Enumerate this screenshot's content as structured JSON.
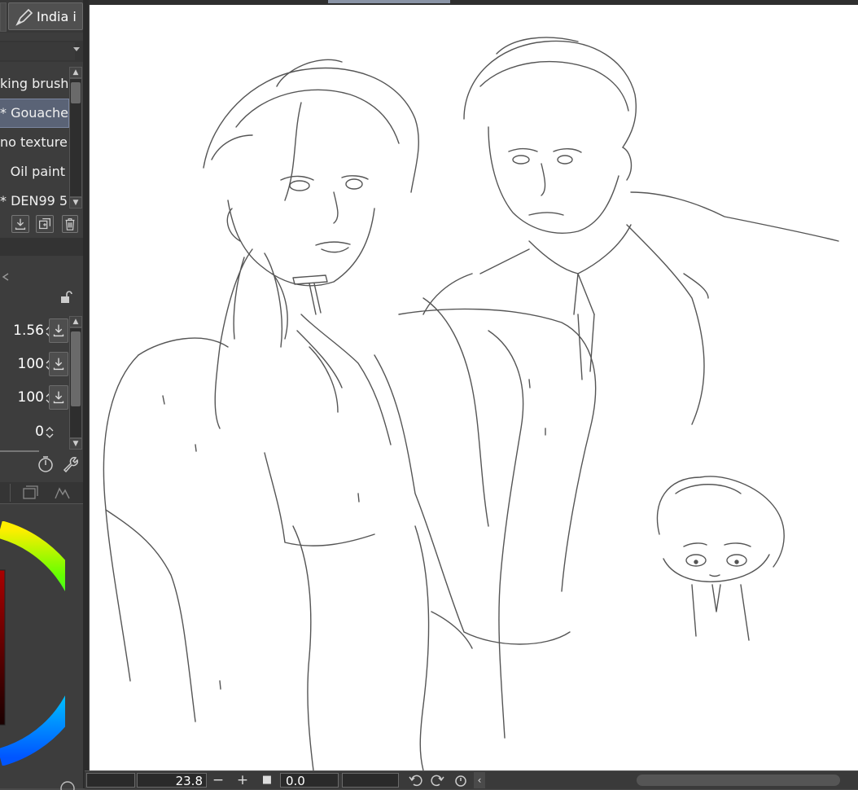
{
  "tool_header": {
    "active_tool": "India i",
    "icon": "pen-icon"
  },
  "brush_list": {
    "items": [
      {
        "label": "king brush",
        "selected": false
      },
      {
        "label": "* Gouache",
        "selected": true
      },
      {
        "label": "no texture",
        "selected": false
      },
      {
        "label": "Oil paint",
        "selected": false
      },
      {
        "label": "* DEN99 5",
        "selected": false
      }
    ]
  },
  "tool_property": {
    "rows": [
      {
        "value": "1.56"
      },
      {
        "value": "100"
      },
      {
        "value": "100"
      },
      {
        "value": "0"
      }
    ]
  },
  "statusbar": {
    "zoom": "23.8",
    "rotation": "0.0",
    "zoom_out": "−",
    "zoom_in": "+",
    "fit": "■"
  },
  "colors": {
    "panel_bg": "#3d3d3d",
    "selected_bg": "#5a6376",
    "canvas_bg": "#ffffff",
    "line_color": "#4a4a4a"
  }
}
